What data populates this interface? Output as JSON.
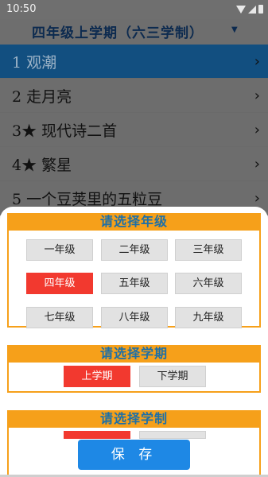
{
  "status_bar": {
    "time": "10:50"
  },
  "header": {
    "title": "四年级上学期（六三学制）",
    "dropdown_icon": "▼"
  },
  "lessons": [
    {
      "label": "1 观潮",
      "selected": true
    },
    {
      "label": "2 走月亮",
      "selected": false
    },
    {
      "label": "3★ 现代诗二首",
      "selected": false
    },
    {
      "label": "4★ 繁星",
      "selected": false
    },
    {
      "label": "5 一个豆荚里的五粒豆",
      "selected": false
    }
  ],
  "modal": {
    "grade_title": "请选择年级",
    "grades": [
      "一年级",
      "二年级",
      "三年级",
      "四年级",
      "五年级",
      "六年级",
      "七年级",
      "八年级",
      "九年级"
    ],
    "selected_grade": "四年级",
    "term_title": "请选择学期",
    "terms": [
      "上学期",
      "下学期"
    ],
    "selected_term": "上学期",
    "system_title": "请选择学制",
    "save_label": "保 存"
  },
  "colors": {
    "accent_orange": "#f6a01a",
    "selected_red": "#f2392f",
    "save_blue": "#1e88e5",
    "header_blue": "#124f80"
  }
}
